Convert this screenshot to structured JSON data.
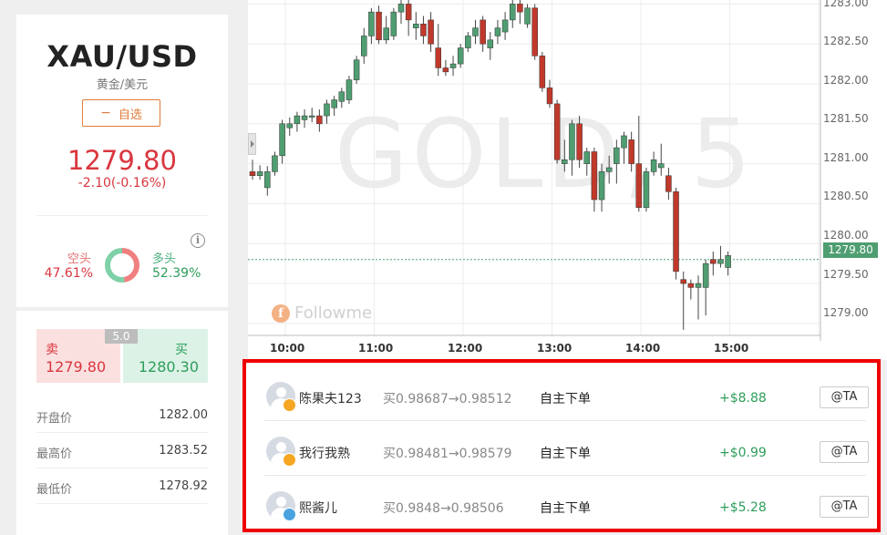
{
  "instrument": {
    "symbol": "XAU/USD",
    "name_cn": "黄金/美元",
    "watchlist_button": "自选",
    "price": "1279.80",
    "change": "-2.10(-0.16%)"
  },
  "sentiment": {
    "short_label": "空头",
    "short_pct": "47.61%",
    "short_value": 47.61,
    "long_label": "多头",
    "long_pct": "52.39%",
    "long_value": 52.39,
    "short_color": "#f08080",
    "long_color": "#7fd1a8"
  },
  "quote": {
    "sell_label": "卖",
    "sell_price": "1279.80",
    "buy_label": "买",
    "buy_price": "1280.30",
    "spread": "5.0"
  },
  "stats": [
    {
      "label": "开盘价",
      "value": "1282.00"
    },
    {
      "label": "最高价",
      "value": "1283.52"
    },
    {
      "label": "最低价",
      "value": "1278.92"
    }
  ],
  "chart": {
    "watermark": "GOLD, 5",
    "brand": "Followme",
    "current_price_tag": "1279.80",
    "y_ticks": [
      "1283.00",
      "1282.50",
      "1282.00",
      "1281.50",
      "1281.00",
      "1280.50",
      "1280.00",
      "1279.50",
      "1279.00"
    ],
    "x_ticks": [
      "10:00",
      "11:00",
      "12:00",
      "13:00",
      "14:00",
      "15:00"
    ],
    "up_color": "#4f9e71",
    "down_color": "#c0392b"
  },
  "chart_data": {
    "type": "candlestick",
    "title": "GOLD, 5",
    "interval_minutes": 5,
    "xlabel": "",
    "ylabel": "",
    "ylim": [
      1278.85,
      1283.05
    ],
    "current_price": 1279.8,
    "x_ticks": [
      "10:00",
      "11:00",
      "12:00",
      "13:00",
      "14:00",
      "15:00"
    ],
    "start_time": "09:40",
    "candles": [
      {
        "o": 1280.9,
        "h": 1281.05,
        "l": 1280.8,
        "c": 1280.85
      },
      {
        "o": 1280.85,
        "h": 1280.98,
        "l": 1280.8,
        "c": 1280.9
      },
      {
        "o": 1280.7,
        "h": 1280.97,
        "l": 1280.6,
        "c": 1280.9
      },
      {
        "o": 1280.9,
        "h": 1281.15,
        "l": 1280.85,
        "c": 1281.1
      },
      {
        "o": 1281.1,
        "h": 1281.55,
        "l": 1281.0,
        "c": 1281.5
      },
      {
        "o": 1281.45,
        "h": 1281.58,
        "l": 1281.35,
        "c": 1281.5
      },
      {
        "o": 1281.5,
        "h": 1281.65,
        "l": 1281.4,
        "c": 1281.6
      },
      {
        "o": 1281.55,
        "h": 1281.68,
        "l": 1281.45,
        "c": 1281.6
      },
      {
        "o": 1281.6,
        "h": 1281.7,
        "l": 1281.52,
        "c": 1281.6
      },
      {
        "o": 1281.6,
        "h": 1281.68,
        "l": 1281.4,
        "c": 1281.5
      },
      {
        "o": 1281.6,
        "h": 1281.8,
        "l": 1281.5,
        "c": 1281.75
      },
      {
        "o": 1281.7,
        "h": 1281.85,
        "l": 1281.6,
        "c": 1281.8
      },
      {
        "o": 1281.78,
        "h": 1281.95,
        "l": 1281.7,
        "c": 1281.9
      },
      {
        "o": 1281.8,
        "h": 1282.1,
        "l": 1281.75,
        "c": 1282.05
      },
      {
        "o": 1282.05,
        "h": 1282.35,
        "l": 1282.0,
        "c": 1282.3
      },
      {
        "o": 1282.35,
        "h": 1282.7,
        "l": 1282.25,
        "c": 1282.6
      },
      {
        "o": 1282.6,
        "h": 1282.95,
        "l": 1282.5,
        "c": 1282.9
      },
      {
        "o": 1282.9,
        "h": 1282.98,
        "l": 1282.5,
        "c": 1282.55
      },
      {
        "o": 1282.55,
        "h": 1282.85,
        "l": 1282.5,
        "c": 1282.7
      },
      {
        "o": 1282.6,
        "h": 1282.95,
        "l": 1282.55,
        "c": 1282.9
      },
      {
        "o": 1282.9,
        "h": 1283.1,
        "l": 1282.75,
        "c": 1283.0
      },
      {
        "o": 1283.0,
        "h": 1283.1,
        "l": 1282.6,
        "c": 1282.8
      },
      {
        "o": 1282.7,
        "h": 1282.9,
        "l": 1282.55,
        "c": 1282.75
      },
      {
        "o": 1282.75,
        "h": 1282.85,
        "l": 1282.5,
        "c": 1282.6
      },
      {
        "o": 1282.8,
        "h": 1282.9,
        "l": 1282.4,
        "c": 1282.5
      },
      {
        "o": 1282.45,
        "h": 1282.75,
        "l": 1282.1,
        "c": 1282.2
      },
      {
        "o": 1282.2,
        "h": 1282.3,
        "l": 1282.1,
        "c": 1282.15
      },
      {
        "o": 1282.2,
        "h": 1282.35,
        "l": 1282.1,
        "c": 1282.25
      },
      {
        "o": 1282.25,
        "h": 1282.5,
        "l": 1282.2,
        "c": 1282.45
      },
      {
        "o": 1282.45,
        "h": 1282.65,
        "l": 1282.4,
        "c": 1282.6
      },
      {
        "o": 1282.6,
        "h": 1282.8,
        "l": 1282.5,
        "c": 1282.7
      },
      {
        "o": 1282.8,
        "h": 1282.85,
        "l": 1282.4,
        "c": 1282.5
      },
      {
        "o": 1282.45,
        "h": 1282.65,
        "l": 1282.3,
        "c": 1282.55
      },
      {
        "o": 1282.6,
        "h": 1282.8,
        "l": 1282.5,
        "c": 1282.7
      },
      {
        "o": 1282.65,
        "h": 1282.9,
        "l": 1282.55,
        "c": 1282.8
      },
      {
        "o": 1282.8,
        "h": 1283.1,
        "l": 1282.7,
        "c": 1283.0
      },
      {
        "o": 1283.0,
        "h": 1283.05,
        "l": 1282.75,
        "c": 1282.9
      },
      {
        "o": 1282.75,
        "h": 1283.0,
        "l": 1282.7,
        "c": 1282.95
      },
      {
        "o": 1282.95,
        "h": 1283.0,
        "l": 1282.3,
        "c": 1282.35
      },
      {
        "o": 1282.35,
        "h": 1282.4,
        "l": 1281.9,
        "c": 1281.95
      },
      {
        "o": 1281.95,
        "h": 1282.05,
        "l": 1281.7,
        "c": 1281.75
      },
      {
        "o": 1281.75,
        "h": 1281.8,
        "l": 1281.0,
        "c": 1281.05
      },
      {
        "o": 1281.0,
        "h": 1281.3,
        "l": 1280.9,
        "c": 1281.05
      },
      {
        "o": 1281.05,
        "h": 1281.55,
        "l": 1280.85,
        "c": 1281.5
      },
      {
        "o": 1281.5,
        "h": 1281.6,
        "l": 1280.95,
        "c": 1281.05
      },
      {
        "o": 1281.0,
        "h": 1281.2,
        "l": 1280.85,
        "c": 1281.15
      },
      {
        "o": 1281.15,
        "h": 1281.2,
        "l": 1280.4,
        "c": 1280.55
      },
      {
        "o": 1280.55,
        "h": 1281.0,
        "l": 1280.4,
        "c": 1280.9
      },
      {
        "o": 1280.9,
        "h": 1281.1,
        "l": 1280.75,
        "c": 1280.95
      },
      {
        "o": 1281.0,
        "h": 1281.3,
        "l": 1280.75,
        "c": 1281.2
      },
      {
        "o": 1281.2,
        "h": 1281.4,
        "l": 1281.0,
        "c": 1281.35
      },
      {
        "o": 1281.3,
        "h": 1281.4,
        "l": 1280.9,
        "c": 1281.0
      },
      {
        "o": 1281.0,
        "h": 1281.6,
        "l": 1280.4,
        "c": 1280.45
      },
      {
        "o": 1280.45,
        "h": 1280.95,
        "l": 1280.4,
        "c": 1280.9
      },
      {
        "o": 1280.9,
        "h": 1281.15,
        "l": 1280.85,
        "c": 1281.05
      },
      {
        "o": 1280.95,
        "h": 1281.25,
        "l": 1280.85,
        "c": 1281.0
      },
      {
        "o": 1280.85,
        "h": 1280.95,
        "l": 1280.55,
        "c": 1280.65
      },
      {
        "o": 1280.65,
        "h": 1280.7,
        "l": 1279.55,
        "c": 1279.65
      },
      {
        "o": 1279.55,
        "h": 1279.65,
        "l": 1278.92,
        "c": 1279.5
      },
      {
        "o": 1279.5,
        "h": 1279.55,
        "l": 1279.3,
        "c": 1279.45
      },
      {
        "o": 1279.45,
        "h": 1279.6,
        "l": 1279.05,
        "c": 1279.5
      },
      {
        "o": 1279.45,
        "h": 1279.8,
        "l": 1279.1,
        "c": 1279.75
      },
      {
        "o": 1279.8,
        "h": 1279.9,
        "l": 1279.6,
        "c": 1279.75
      },
      {
        "o": 1279.75,
        "h": 1279.97,
        "l": 1279.7,
        "c": 1279.8
      },
      {
        "o": 1279.7,
        "h": 1279.9,
        "l": 1279.6,
        "c": 1279.85
      }
    ]
  },
  "activity": [
    {
      "user": "陈果夫123",
      "trade": "买0.98687→0.98512",
      "type": "自主下单",
      "profit": "+$8.88",
      "action": "@TA",
      "badge_color": "#f5a623"
    },
    {
      "user": "我行我熟",
      "trade": "买0.98481→0.98579",
      "type": "自主下单",
      "profit": "+$0.99",
      "action": "@TA",
      "badge_color": "#f5a623"
    },
    {
      "user": "熙酱儿",
      "trade": "买0.9848→0.98506",
      "type": "自主下单",
      "profit": "+$5.28",
      "action": "@TA",
      "badge_color": "#4aa3df"
    }
  ]
}
